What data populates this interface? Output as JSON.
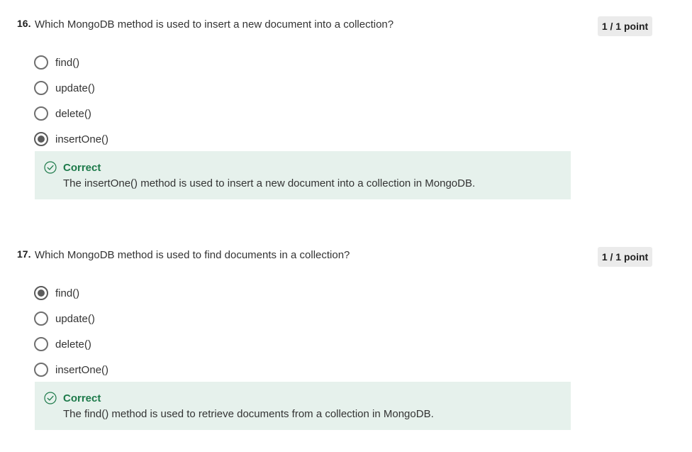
{
  "questions": [
    {
      "number": "16.",
      "text": "Which MongoDB method is used to insert a new document into a collection?",
      "points": "1 / 1 point",
      "options": [
        {
          "label": "find()",
          "selected": false
        },
        {
          "label": "update()",
          "selected": false
        },
        {
          "label": "delete()",
          "selected": false
        },
        {
          "label": "insertOne()",
          "selected": true
        }
      ],
      "feedback": {
        "title": "Correct",
        "text": "The insertOne() method is used to insert a new document into a collection in MongoDB.",
        "icon": "check-circle-icon"
      }
    },
    {
      "number": "17.",
      "text": "Which MongoDB method is used to find documents in a collection?",
      "points": "1 / 1 point",
      "options": [
        {
          "label": "find()",
          "selected": true
        },
        {
          "label": "update()",
          "selected": false
        },
        {
          "label": "delete()",
          "selected": false
        },
        {
          "label": "insertOne()",
          "selected": false
        }
      ],
      "feedback": {
        "title": "Correct",
        "text": "The find() method is used to retrieve documents from a collection in MongoDB.",
        "icon": "check-circle-icon"
      }
    }
  ],
  "colors": {
    "feedback_background": "#e6f1ec",
    "correct_green": "#1d7a4a",
    "badge_background": "#ebebeb",
    "radio_border": "#6f6f6f"
  }
}
